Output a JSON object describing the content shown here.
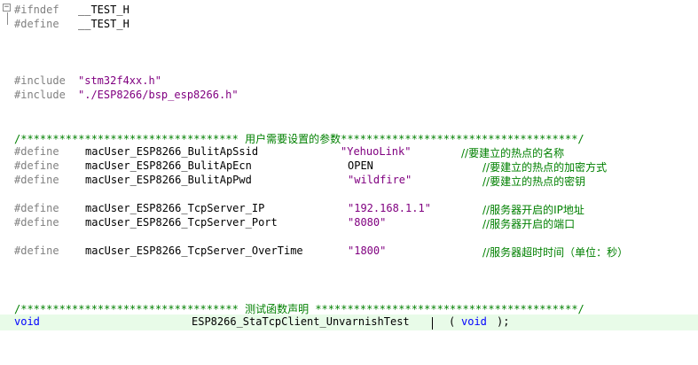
{
  "fold_marker": "−",
  "lines": {
    "ifndef": {
      "directive": "#ifndef",
      "name": "__TEST_H"
    },
    "define_guard": {
      "directive": "#define",
      "name": "__TEST_H"
    },
    "include1": {
      "directive": "#include",
      "path": "\"stm32f4xx.h\""
    },
    "include2": {
      "directive": "#include",
      "path": "\"./ESP8266/bsp_esp8266.h\""
    },
    "sep1": {
      "left": "/********************************** ",
      "text": "用户需要设置的参数",
      "right": "*************************************/"
    },
    "defines": [
      {
        "directive": "#define",
        "name": "macUser_ESP8266_BulitApSsid",
        "value": "\"YehuoLink\"",
        "comment": "//要建立的热点的名称"
      },
      {
        "directive": "#define",
        "name": "macUser_ESP8266_BulitApEcn",
        "value": "OPEN",
        "comment": "//要建立的热点的加密方式"
      },
      {
        "directive": "#define",
        "name": "macUser_ESP8266_BulitApPwd",
        "value": "\"wildfire\"",
        "comment": "//要建立的热点的密钥"
      },
      {
        "directive": "#define",
        "name": "macUser_ESP8266_TcpServer_IP",
        "value": "\"192.168.1.1\"",
        "comment": "//服务器开启的IP地址"
      },
      {
        "directive": "#define",
        "name": "macUser_ESP8266_TcpServer_Port",
        "value": "\"8080\"",
        "comment": "//服务器开启的端口"
      },
      {
        "directive": "#define",
        "name": "macUser_ESP8266_TcpServer_OverTime",
        "value": "\"1800\"",
        "comment": "//服务器超时时间（单位：秒）"
      }
    ],
    "sep2": {
      "left": "/********************************** ",
      "text": "测试函数声明",
      "right": " *****************************************/"
    },
    "decl": {
      "type": "void",
      "func": "ESP8266_StaTcpClient_UnvarnishTest",
      "open": "(",
      "arg": "void",
      "close": ");"
    }
  }
}
